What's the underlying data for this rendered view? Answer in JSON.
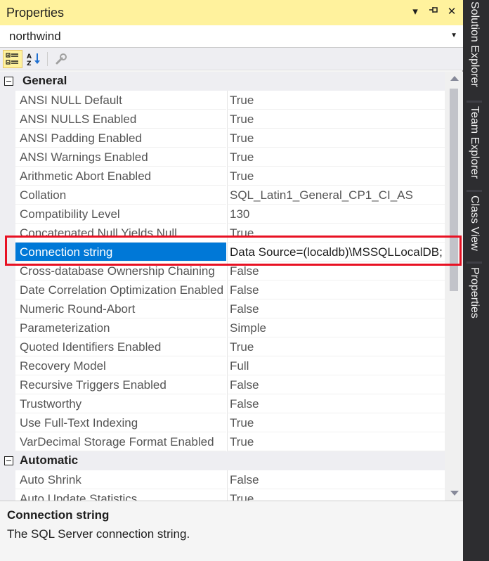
{
  "window": {
    "title": "Properties",
    "controls": [
      "▾",
      "⊣",
      "✕"
    ]
  },
  "object_selector": {
    "value": "northwind"
  },
  "toolbar": {
    "buttons": [
      "categorized",
      "alphabetical",
      "property-pages"
    ]
  },
  "categories": [
    {
      "label": "General",
      "properties": [
        {
          "name": "ANSI NULL Default",
          "value": "True"
        },
        {
          "name": "ANSI NULLS Enabled",
          "value": "True"
        },
        {
          "name": "ANSI Padding Enabled",
          "value": "True"
        },
        {
          "name": "ANSI Warnings Enabled",
          "value": "True"
        },
        {
          "name": "Arithmetic Abort Enabled",
          "value": "True"
        },
        {
          "name": "Collation",
          "value": "SQL_Latin1_General_CP1_CI_AS"
        },
        {
          "name": "Compatibility Level",
          "value": "130"
        },
        {
          "name": "Concatenated Null Yields Null",
          "value": "True"
        },
        {
          "name": "Connection string",
          "value": "Data Source=(localdb)\\MSSQLLocalDB;",
          "selected": true
        },
        {
          "name": "Cross-database Ownership Chaining",
          "value": "False"
        },
        {
          "name": "Date Correlation Optimization Enabled",
          "value": "False"
        },
        {
          "name": "Numeric Round-Abort",
          "value": "False"
        },
        {
          "name": "Parameterization",
          "value": "Simple"
        },
        {
          "name": "Quoted Identifiers Enabled",
          "value": "True"
        },
        {
          "name": "Recovery Model",
          "value": "Full"
        },
        {
          "name": "Recursive Triggers Enabled",
          "value": "False"
        },
        {
          "name": "Trustworthy",
          "value": "False"
        },
        {
          "name": "Use Full-Text Indexing",
          "value": "True"
        },
        {
          "name": "VarDecimal Storage Format Enabled",
          "value": "True"
        }
      ]
    },
    {
      "label": "Automatic",
      "properties": [
        {
          "name": "Auto Shrink",
          "value": "False"
        },
        {
          "name": "Auto Update Statistics",
          "value": "True"
        }
      ]
    }
  ],
  "description": {
    "title": "Connection string",
    "text": "The SQL Server connection string."
  },
  "side_tabs": [
    "Solution Explorer",
    "Team Explorer",
    "Class View",
    "Properties"
  ],
  "colors": {
    "title_bar": "#fff29d",
    "selection": "#0078d7",
    "highlight_box": "#e81123"
  }
}
